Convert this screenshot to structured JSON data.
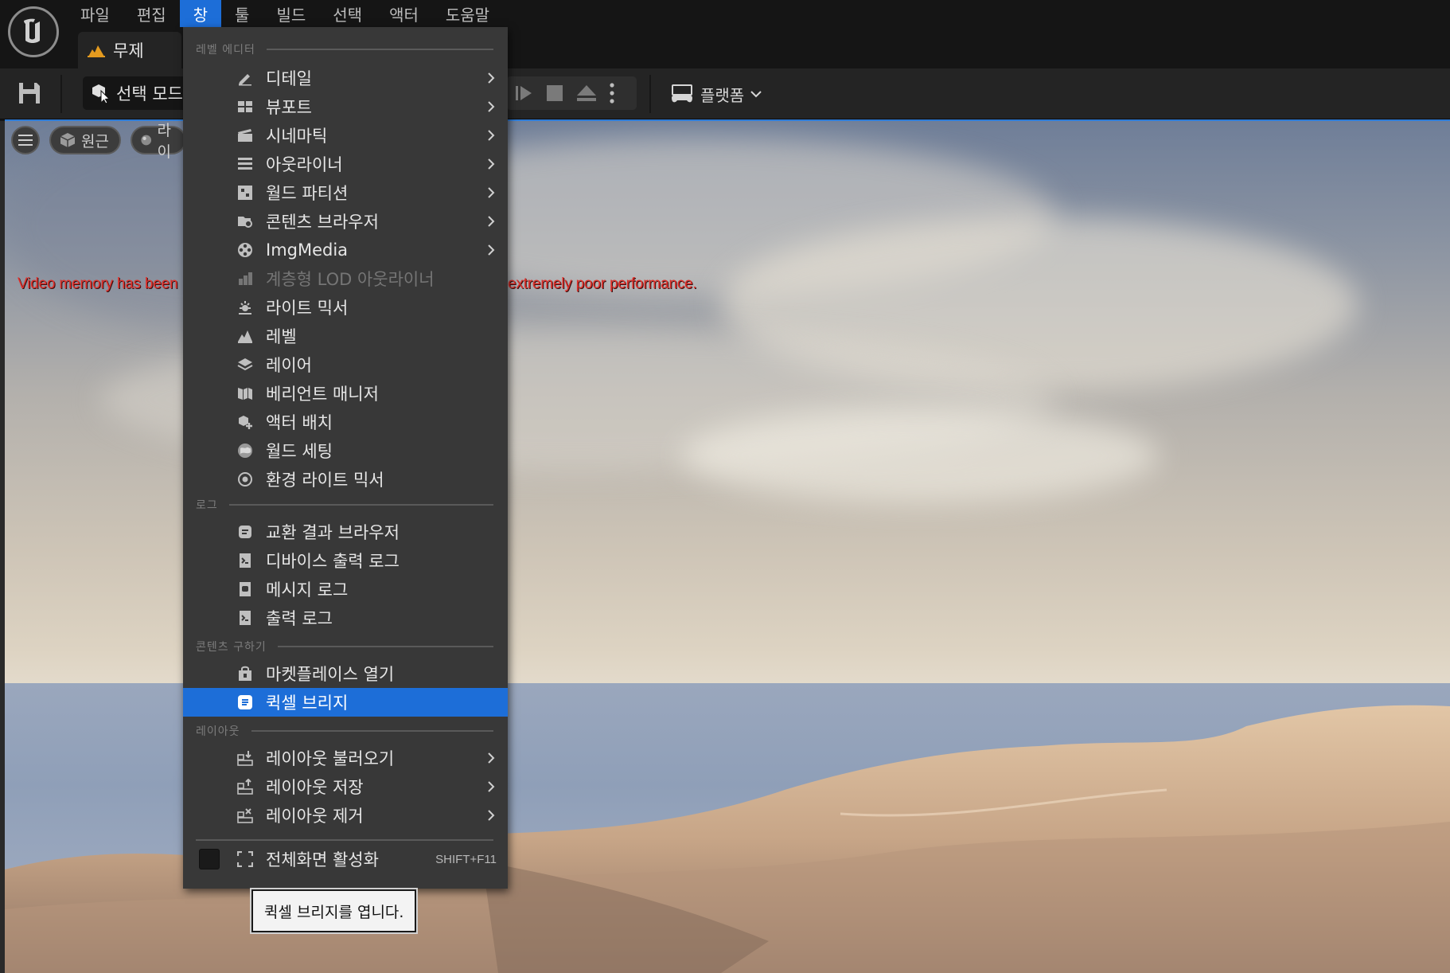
{
  "menubar": {
    "items": [
      "파일",
      "편집",
      "창",
      "툴",
      "빌드",
      "선택",
      "액터",
      "도움말"
    ],
    "active": "창"
  },
  "level_tab": {
    "label": "무제"
  },
  "toolbar": {
    "select_mode": "선택 모드",
    "platform": "플랫폼"
  },
  "viewport": {
    "perspective_label": "원근",
    "lit_label": "라이",
    "warning_left": "Video memory has been",
    "warning_right": "extremely poor performance."
  },
  "dropdown": {
    "sections": {
      "level_editor": "레벨 에디터",
      "log": "로그",
      "get_content": "콘텐츠 구하기",
      "layout": "레이아웃"
    },
    "level_editor_items": [
      {
        "label": "디테일",
        "icon": "details-icon",
        "submenu": true
      },
      {
        "label": "뷰포트",
        "icon": "viewport-icon",
        "submenu": true
      },
      {
        "label": "시네마틱",
        "icon": "clapper-icon",
        "submenu": true
      },
      {
        "label": "아웃라이너",
        "icon": "outliner-icon",
        "submenu": true
      },
      {
        "label": "월드 파티션",
        "icon": "world-partition-icon",
        "submenu": true
      },
      {
        "label": "콘텐츠 브라우저",
        "icon": "content-browser-icon",
        "submenu": true
      },
      {
        "label": "ImgMedia",
        "icon": "film-reel-icon",
        "submenu": true
      },
      {
        "label": "계층형 LOD 아웃라이너",
        "icon": "hlod-icon",
        "submenu": false,
        "disabled": true
      },
      {
        "label": "라이트 믹서",
        "icon": "light-icon",
        "submenu": false
      },
      {
        "label": "레벨",
        "icon": "levels-icon",
        "submenu": false
      },
      {
        "label": "레이어",
        "icon": "layers-icon",
        "submenu": false
      },
      {
        "label": "베리언트 매니저",
        "icon": "variant-manager-icon",
        "submenu": false
      },
      {
        "label": "액터 배치",
        "icon": "place-actor-icon",
        "submenu": false
      },
      {
        "label": "월드 세팅",
        "icon": "world-settings-icon",
        "submenu": false
      },
      {
        "label": "환경 라이트 믹서",
        "icon": "env-light-icon",
        "submenu": false
      }
    ],
    "log_items": [
      {
        "label": "교환 결과 브라우저",
        "icon": "interchange-icon"
      },
      {
        "label": "디바이스 출력 로그",
        "icon": "device-log-icon"
      },
      {
        "label": "메시지 로그",
        "icon": "message-log-icon"
      },
      {
        "label": "출력 로그",
        "icon": "output-log-icon"
      }
    ],
    "content_items": [
      {
        "label": "마켓플레이스 열기",
        "icon": "marketplace-icon"
      },
      {
        "label": "퀵셀 브리지",
        "icon": "bridge-icon",
        "highlighted": true
      }
    ],
    "layout_items": [
      {
        "label": "레이아웃 불러오기",
        "icon": "layout-load-icon",
        "submenu": true
      },
      {
        "label": "레이아웃 저장",
        "icon": "layout-save-icon",
        "submenu": true
      },
      {
        "label": "레이아웃 제거",
        "icon": "layout-remove-icon",
        "submenu": true
      }
    ],
    "fullscreen": {
      "label": "전체화면 활성화",
      "shortcut": "SHIFT+F11",
      "checked": false
    }
  },
  "tooltip": {
    "text": "퀵셀 브리지를 엽니다."
  },
  "colors": {
    "accent": "#1d6ed8",
    "warning": "#e0302a",
    "menu_bg": "#383838"
  }
}
